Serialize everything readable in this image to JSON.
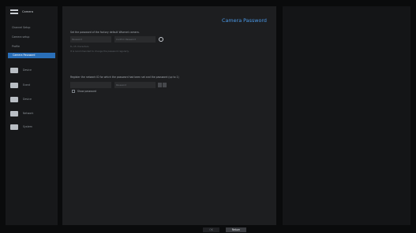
{
  "sidebar": {
    "header": "Camera",
    "items": [
      "Channel Setup",
      "Camera setup",
      "Profile",
      "Camera Password"
    ],
    "active_item": "Camera Password",
    "categories": [
      {
        "label": "Device",
        "icon": "monitor-icon"
      },
      {
        "label": "Event",
        "icon": "person-icon"
      },
      {
        "label": "Device",
        "icon": "device-icon"
      },
      {
        "label": "Network",
        "icon": "network-icon"
      },
      {
        "label": "System",
        "icon": "system-icon"
      }
    ]
  },
  "main": {
    "title": "Camera Password",
    "set_password_text": "Set the password of the factory default Wisenet camera.",
    "password_placeholder": "Password",
    "confirm_placeholder": "Confirm Password",
    "hint1": "8~15 characters",
    "hint2": "It is recommended to change the password regularly.",
    "register_text": "Register the network ID for which the password had been set and the password (up to 1)",
    "register_field_value": "Password",
    "show_password_label": "Show password"
  },
  "buttons": {
    "ok": "OK",
    "return": "Return"
  },
  "colors": {
    "accent": "#4a98e6",
    "active_item_bg": "#2a6fb8",
    "background": "#0c0d0f",
    "panel": "#1d1e20"
  }
}
